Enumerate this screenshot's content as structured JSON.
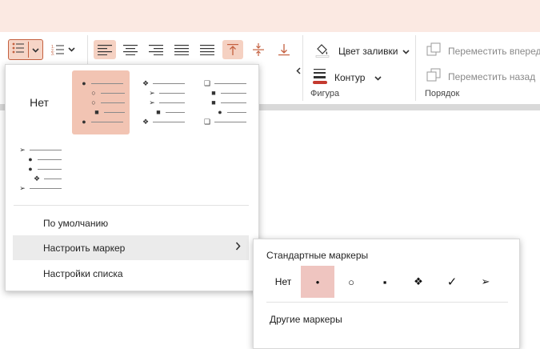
{
  "ribbon": {
    "fill_color_label": "Цвет заливки",
    "outline_label": "Контур",
    "bring_forward_label": "Переместить вперед",
    "send_backward_label": "Переместить назад",
    "group_shape_label": "Фигура",
    "group_arrange_label": "Порядок",
    "accent_color": "#c4603f",
    "outline_color": "#c43a2f"
  },
  "bullet_library": {
    "none_label": "Нет",
    "selected_style": "filled-circle-hollow-circle-square"
  },
  "menu": {
    "default_label": "По умолчанию",
    "customize_marker_label": "Настроить маркер",
    "list_settings_label": "Настройки списка"
  },
  "submenu": {
    "title": "Стандартные маркеры",
    "none_label": "Нет",
    "markers": [
      "•",
      "○",
      "▪",
      "❖",
      "✓",
      "➢"
    ],
    "selected_marker": "•",
    "more_label": "Другие маркеры"
  }
}
